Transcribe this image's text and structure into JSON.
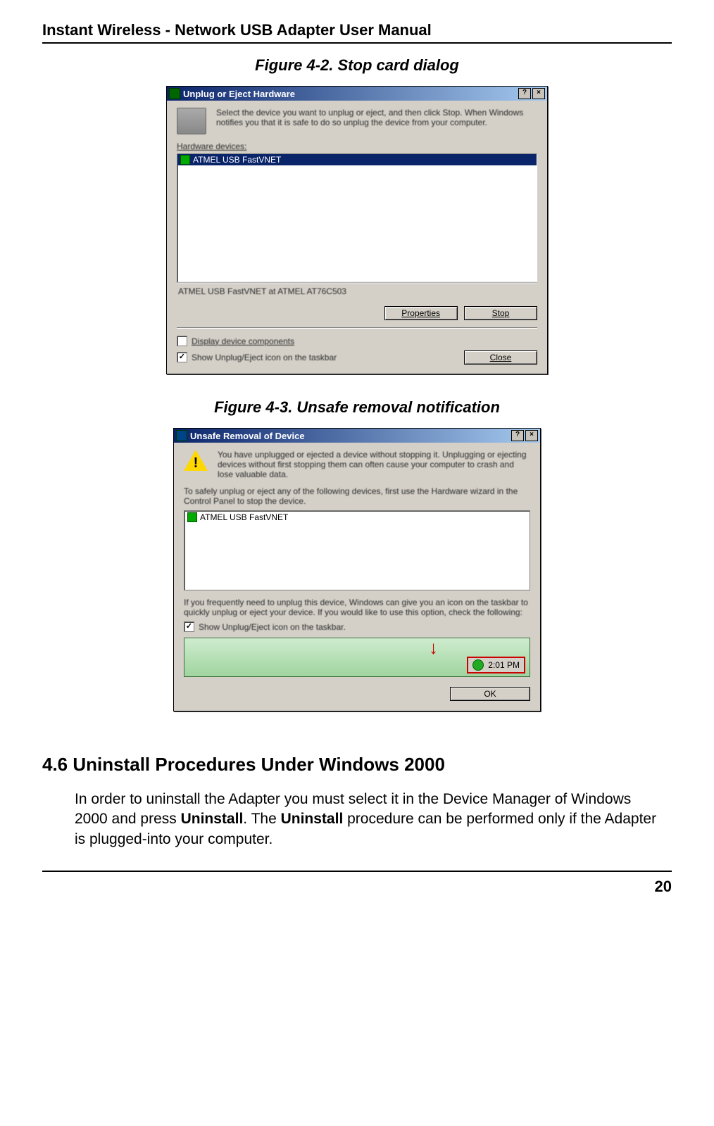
{
  "header": {
    "title": "Instant Wireless - Network USB Adapter User Manual"
  },
  "figures": {
    "fig42": {
      "caption": "Figure 4-2. Stop card dialog",
      "dialog": {
        "title": "Unplug or Eject Hardware",
        "intro": "Select the device you want to unplug or eject, and then click Stop. When Windows notifies you that it is safe to do so unplug the device from your computer.",
        "hw_label": "Hardware devices:",
        "list_item": "ATMEL USB FastVNET",
        "status": "ATMEL USB FastVNET at ATMEL AT76C503",
        "btn_properties": "Properties",
        "btn_stop": "Stop",
        "chk_display": "Display device components",
        "chk_show": "Show Unplug/Eject icon on the taskbar",
        "btn_close": "Close",
        "help_btn": "?",
        "close_btn": "×"
      }
    },
    "fig43": {
      "caption": "Figure 4-3. Unsafe removal notification",
      "dialog": {
        "title": "Unsafe Removal of Device",
        "warn_text": "You have unplugged or ejected a device without stopping it. Unplugging or ejecting devices without first stopping them can often cause your computer to crash and lose valuable data.",
        "instr": "To safely unplug or eject any of the following devices, first use the Hardware wizard in the Control Panel to stop the device.",
        "list_item": "ATMEL USB FastVNET",
        "freq_text": "If you frequently need to unplug this device, Windows can give you an icon on the taskbar to quickly unplug or eject your device. If you would like to use this option, check the following:",
        "chk_show": "Show Unplug/Eject icon on the taskbar.",
        "tray_time": "2:01 PM",
        "btn_ok": "OK",
        "help_btn": "?",
        "close_btn": "×"
      }
    }
  },
  "section": {
    "title": "4.6 Uninstall Procedures Under Windows 2000",
    "para_pre": "In order to uninstall the Adapter you must select it in the Device Manager of Windows 2000 and press ",
    "bold1": "Uninstall",
    "para_mid": ". The ",
    "bold2": "Uninstall",
    "para_post": " procedure can be performed only if the Adapter is plugged-into your computer."
  },
  "footer": {
    "page": "20"
  }
}
